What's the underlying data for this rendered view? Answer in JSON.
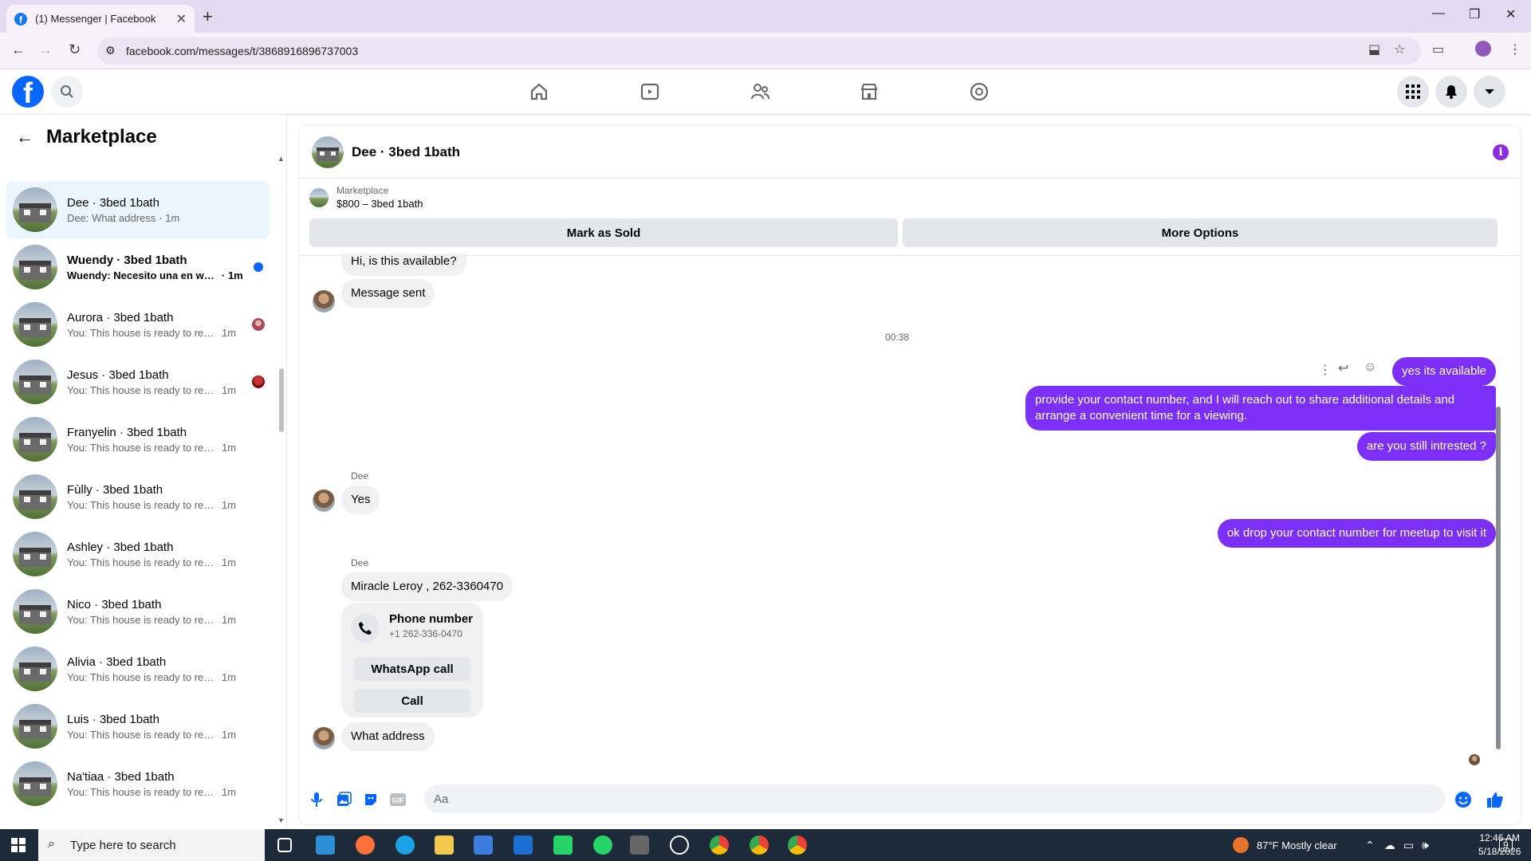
{
  "browser": {
    "tab_title": "(1) Messenger | Facebook",
    "url": "facebook.com/messages/t/3868916896737003"
  },
  "sidebar": {
    "title": "Marketplace",
    "conversations": [
      {
        "name": "Dee · 3bed 1bath",
        "preview": "Dee: What address",
        "time": "· 1m",
        "active": true
      },
      {
        "name": "Wuendy · 3bed 1bath",
        "preview": "Wuendy: Necesito una en wau...",
        "time": "· 1m",
        "unread": true
      },
      {
        "name": "Aurora · 3bed 1bath",
        "preview": "You: This house is ready to rent...",
        "time": "1m"
      },
      {
        "name": "Jesus · 3bed 1bath",
        "preview": "You: This house is ready to rent...",
        "time": "1m"
      },
      {
        "name": "Franyelin · 3bed 1bath",
        "preview": "You: This house is ready to rented ...",
        "time": "1m"
      },
      {
        "name": "Fùlly · 3bed 1bath",
        "preview": "You: This house is ready to rented ...",
        "time": "1m"
      },
      {
        "name": "Ashley · 3bed 1bath",
        "preview": "You: This house is ready to rented ...",
        "time": "1m"
      },
      {
        "name": "Nico · 3bed 1bath",
        "preview": "You: This house is ready to rented ...",
        "time": "1m"
      },
      {
        "name": "Alivia · 3bed 1bath",
        "preview": "You: This house is ready to rented ...",
        "time": "1m"
      },
      {
        "name": "Luis · 3bed 1bath",
        "preview": "You: This house is ready to rented ...",
        "time": "1m"
      },
      {
        "name": "Na'tiaa · 3bed 1bath",
        "preview": "You: This house is ready to rented ...",
        "time": "1m"
      }
    ]
  },
  "chat": {
    "title": "Dee · 3bed 1bath",
    "listing_source": "Marketplace",
    "listing_price": "$800 – 3bed 1bath",
    "mark_sold": "Mark as Sold",
    "more_options": "More Options",
    "messages": {
      "m1": "Hi, is this available?",
      "m2": "Message sent",
      "timestamp": "00:38",
      "o1": "yes its available",
      "o2": "provide your contact number, and I will reach out to share additional details and arrange a convenient time for a viewing.",
      "o3": "are you still intrested ?",
      "sender1": "Dee",
      "m3": "Yes",
      "o4": "ok drop your contact number for meetup to visit it",
      "sender2": "Dee",
      "m4": "Miracle Leroy , 262-3360470",
      "card_title": "Phone number",
      "card_number": "+1 262-336-0470",
      "card_whatsapp": "WhatsApp call",
      "card_call": "Call",
      "m5": "What address"
    },
    "composer_placeholder": "Aa"
  },
  "taskbar": {
    "search_placeholder": "Type here to search",
    "weather": "87°F  Mostly clear",
    "time": "12:46 AM",
    "date": "5/18/2026",
    "notif_count": "9"
  },
  "colors": {
    "accent": "#0866ff",
    "outgoing_bubble": "#7b2ff7"
  }
}
